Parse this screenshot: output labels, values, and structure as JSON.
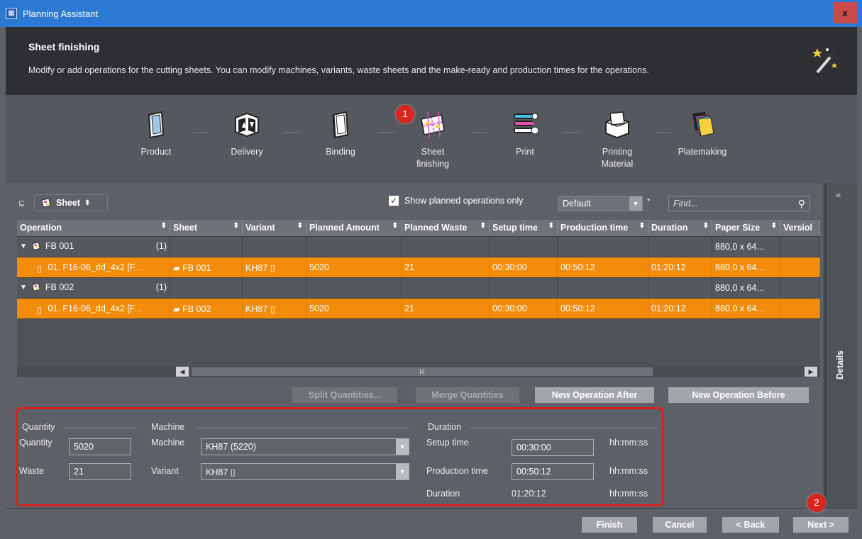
{
  "window": {
    "title": "Planning Assistant",
    "close_label": "x"
  },
  "header": {
    "title": "Sheet finishing",
    "description": "Modify or add operations for the cutting sheets. You can modify machines, variants, waste sheets and the make-ready and production times for the operations."
  },
  "steps": [
    {
      "label": "Product"
    },
    {
      "label": "Delivery"
    },
    {
      "label": "Binding"
    },
    {
      "label_line1": "Sheet",
      "label_line2": "finishing",
      "badge": "1"
    },
    {
      "label": "Print"
    },
    {
      "label_line1": "Printing",
      "label_line2": "Material"
    },
    {
      "label": "Platemaking"
    }
  ],
  "toolbar": {
    "sheet_label": "Sheet",
    "show_planned_label": "Show planned operations only",
    "show_planned_checked": true,
    "filter_value": "Default",
    "asterisk": "*",
    "find_placeholder": "Find..."
  },
  "grid": {
    "columns": [
      "Operation",
      "Sheet",
      "Variant",
      "Planned Amount",
      "Planned Waste",
      "Setup time",
      "Production time",
      "Duration",
      "Paper Size",
      "Versiol"
    ],
    "rows": [
      {
        "type": "group",
        "operation": "FB 001",
        "count": "(1)",
        "paper_size": "880,0 x 64..."
      },
      {
        "type": "item",
        "operation": "01. F16-06_dd_4x2 [F...",
        "sheet": "FB 001",
        "variant": "KH87",
        "planned_amount": "5020",
        "planned_waste": "21",
        "setup_time": "00:30:00",
        "production_time": "00:50:12",
        "duration": "01:20:12",
        "paper_size": "880,0 x 64..."
      },
      {
        "type": "group",
        "operation": "FB 002",
        "count": "(1)",
        "paper_size": "880,0 x 64..."
      },
      {
        "type": "item",
        "operation": "01. F16-06_dd_4x2 [F...",
        "sheet": "FB 002",
        "variant": "KH87",
        "planned_amount": "5020",
        "planned_waste": "21",
        "setup_time": "00:30:00",
        "production_time": "00:50:12",
        "duration": "01:20:12",
        "paper_size": "880,0 x 64..."
      }
    ],
    "scroll_thumb": "III"
  },
  "actions": {
    "split": "Split Quantities...",
    "merge": "Merge Quantities",
    "new_after": "New Operation After",
    "new_before": "New Operation Before"
  },
  "form": {
    "quantity_section": "Quantity",
    "quantity_label": "Quantity",
    "quantity_value": "5020",
    "waste_label": "Waste",
    "waste_value": "21",
    "machine_section": "Machine",
    "machine_label": "Machine",
    "machine_value": "KH87 (5220)",
    "variant_label": "Variant",
    "variant_value": "KH87",
    "duration_section": "Duration",
    "setup_label": "Setup time",
    "setup_value": "00:30:00",
    "production_label": "Production time",
    "production_value": "00:50:12",
    "duration_label": "Duration",
    "duration_value": "01:20:12",
    "unit": "hh:mm:ss"
  },
  "sidebar": {
    "collapse": "«",
    "details_label": "Details"
  },
  "footer": {
    "finish": "Finish",
    "cancel": "Cancel",
    "back": "< Back",
    "next": "Next >",
    "badge": "2"
  },
  "colors": {
    "accent": "#f28c0a",
    "badge": "#d9261c",
    "highlight": "#d92020",
    "titlebar": "#2b79d3"
  }
}
